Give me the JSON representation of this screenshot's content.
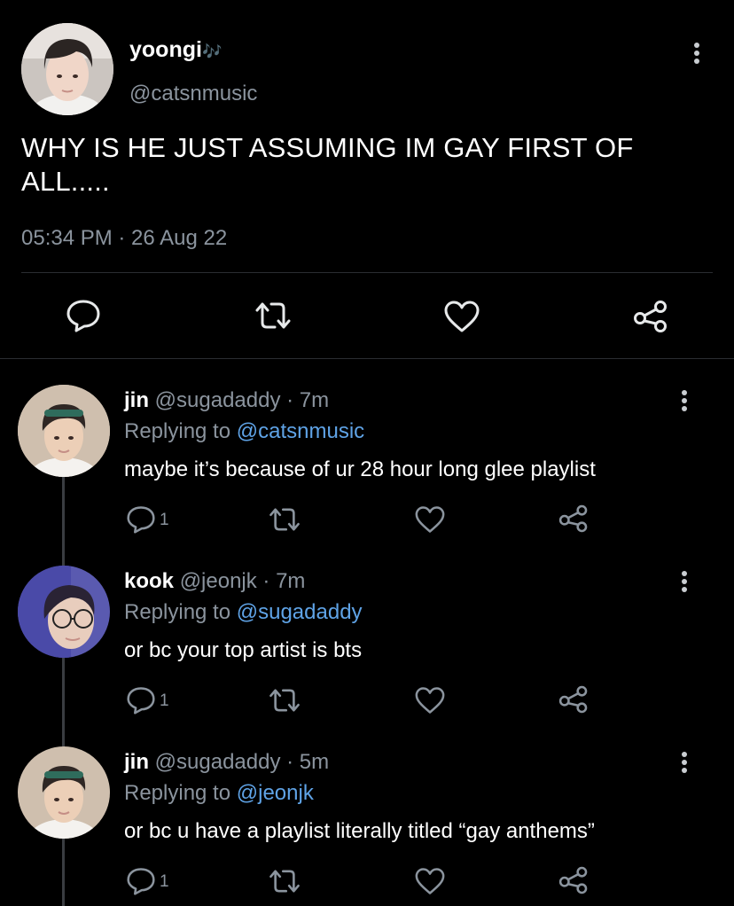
{
  "main_tweet": {
    "name": "yoongi",
    "name_emoji": "🎶",
    "handle": "@catsnmusic",
    "text": "WHY IS HE JUST ASSUMING IM GAY FIRST OF ALL.....",
    "timestamp": "05:34 PM · 26 Aug 22",
    "actions": [
      "reply-icon",
      "retweet-icon",
      "like-icon",
      "share-icon"
    ]
  },
  "replies": [
    {
      "name": "jin",
      "meta": "@sugadaddy · 7m",
      "replying_prefix": "Replying to",
      "replying_to": "@catsnmusic",
      "text": "maybe it’s because of ur 28 hour long glee playlist",
      "reply_count": "1"
    },
    {
      "name": "kook",
      "meta": "@jeonjk · 7m",
      "replying_prefix": "Replying to",
      "replying_to": "@sugadaddy",
      "text": "or bc your top artist is bts",
      "reply_count": "1"
    },
    {
      "name": "jin",
      "meta": "@sugadaddy · 5m",
      "replying_prefix": "Replying to",
      "replying_to": "@jeonjk",
      "text": "or bc u have a playlist literally titled “gay anthems”",
      "reply_count": "1"
    }
  ],
  "colors": {
    "background": "#000000",
    "text": "#ffffff",
    "secondary": "#8b949e",
    "mention": "#5fa3e6",
    "divider": "#2a2d31"
  }
}
